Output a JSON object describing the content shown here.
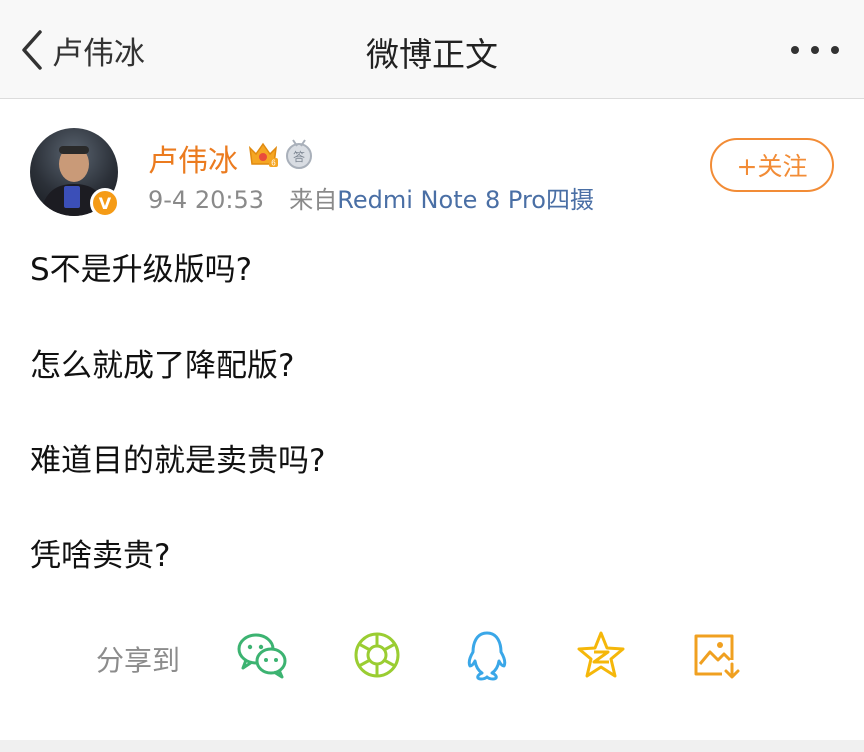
{
  "navbar": {
    "back_label": "卢伟冰",
    "title": "微博正文"
  },
  "post": {
    "author": "卢伟冰",
    "time": "9-4 20:53",
    "source_prefix": "来自",
    "source": "Redmi Note 8 Pro四摄",
    "follow_label": "+关注",
    "lines": [
      "S不是升级版吗?",
      "怎么就成了降配版?",
      "难道目的就是卖贵吗?",
      "凭啥卖贵?"
    ]
  },
  "share": {
    "label": "分享到",
    "targets": [
      "wechat-icon",
      "moments-icon",
      "qq-icon",
      "qzone-icon",
      "save-image-icon"
    ]
  },
  "colors": {
    "accent": "#eb7b1f",
    "link": "#4a6fa5",
    "wechat": "#3cb371",
    "moments": "#9acd32",
    "qq": "#3aa7e8",
    "qzone": "#f5b70a",
    "save": "#f0a020"
  }
}
